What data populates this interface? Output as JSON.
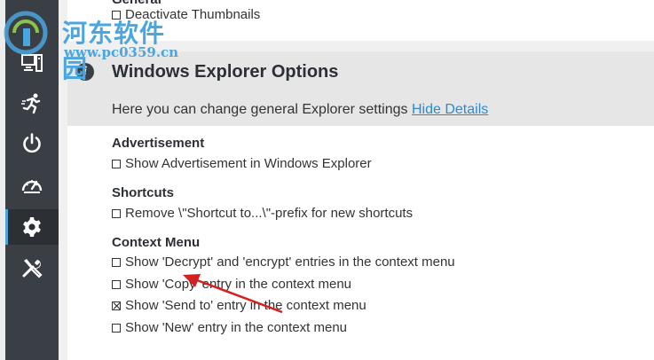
{
  "sidebar": {
    "items": [
      {
        "icon": "computer-icon"
      },
      {
        "icon": "running-person-icon"
      },
      {
        "icon": "power-icon"
      },
      {
        "icon": "speedometer-icon"
      },
      {
        "icon": "gear-icon",
        "active": true
      },
      {
        "icon": "tools-icon"
      }
    ]
  },
  "general": {
    "partial_label": "General",
    "deactivate_thumbnails": "Deactivate Thumbnails"
  },
  "explorer_options": {
    "title": "Windows Explorer Options",
    "description": "Here you can change general Explorer settings",
    "hide_details": "Hide Details"
  },
  "sections": {
    "advertisement": {
      "title": "Advertisement",
      "option": "Show Advertisement in Windows Explorer"
    },
    "shortcuts": {
      "title": "Shortcuts",
      "option": "Remove \\\"Shortcut to...\\\"-prefix for new shortcuts"
    },
    "context_menu": {
      "title": "Context Menu",
      "options": [
        {
          "label": "Show 'Decrypt' and 'encrypt' entries in the context menu",
          "checked": false
        },
        {
          "label": "Show 'Copy' entry in the context menu",
          "checked": false
        },
        {
          "label": "Show 'Send to' entry in the context menu",
          "checked": true
        },
        {
          "label": "Show 'New' entry in the context menu",
          "checked": false
        }
      ]
    }
  },
  "watermark": {
    "site_name": "河东软件园",
    "url": "www.pc0359.cn"
  },
  "colors": {
    "sidebar_bg": "#3a3f45",
    "accent": "#4ea3d8",
    "link": "#2a8ccf",
    "annotation_arrow": "#d42020"
  }
}
